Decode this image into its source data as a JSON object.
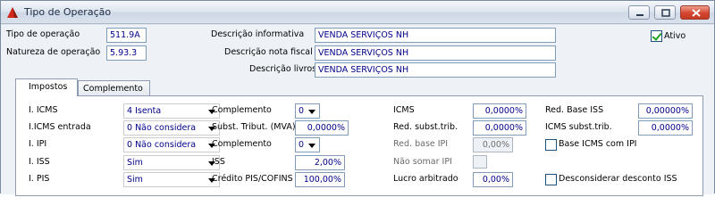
{
  "window": {
    "title": "Tipo de Operação"
  },
  "header": {
    "tipo_label": "Tipo de operação",
    "tipo_value": "511.9A",
    "natureza_label": "Natureza de operação",
    "natureza_value": "5.93.3",
    "desc_info_label": "Descrição informativa",
    "desc_info_value": "VENDA SERVIÇOS NH",
    "desc_nota_label": "Descrição nota fiscal",
    "desc_nota_value": "VENDA SERVIÇOS NH",
    "desc_livros_label": "Descrição livros",
    "desc_livros_value": "VENDA SERVIÇOS NH",
    "ativo_label": "Ativo",
    "ativo_checked": true
  },
  "tabs": [
    {
      "label": "Impostos"
    },
    {
      "label": "Complemento"
    }
  ],
  "impostos": {
    "col1": [
      {
        "label": "I. ICMS",
        "value": "4 Isenta"
      },
      {
        "label": "I.ICMS entrada",
        "value": "0 Não considera"
      },
      {
        "label": "I. IPI",
        "value": "0 Não considera"
      },
      {
        "label": "I. ISS",
        "value": "Sim"
      },
      {
        "label": "I. PIS",
        "value": "Sim"
      }
    ],
    "col2": {
      "complemento_label": "Complemento",
      "complemento_value": "0",
      "subst_label": "Subst. Tribut. (MVA)",
      "subst_value": "0,0000%",
      "complemento2_label": "Complemento",
      "complemento2_value": "0",
      "iss_label": "ISS",
      "iss_value": "2,00%",
      "credito_label": "Crédito PIS/COFINS",
      "credito_value": "100,00%"
    },
    "col3": {
      "icms_label": "ICMS",
      "icms_value": "0,0000%",
      "red_subst_label": "Red. subst.trib.",
      "red_subst_value": "0,0000%",
      "red_base_ipi_label": "Red. base IPI",
      "red_base_ipi_value": "0,00%",
      "nao_somar_label": "Não somar IPI",
      "lucro_label": "Lucro arbitrado",
      "lucro_value": "0,00%"
    },
    "col4": {
      "red_base_iss_label": "Red. Base ISS",
      "red_base_iss_value": "0,00000%",
      "icms_subst_label": "ICMS subst.trib.",
      "icms_subst_value": "0,0000%",
      "base_icms_ipi_label": "Base ICMS com IPI",
      "desconsiderar_label": "Desconsiderar desconto ISS"
    }
  }
}
